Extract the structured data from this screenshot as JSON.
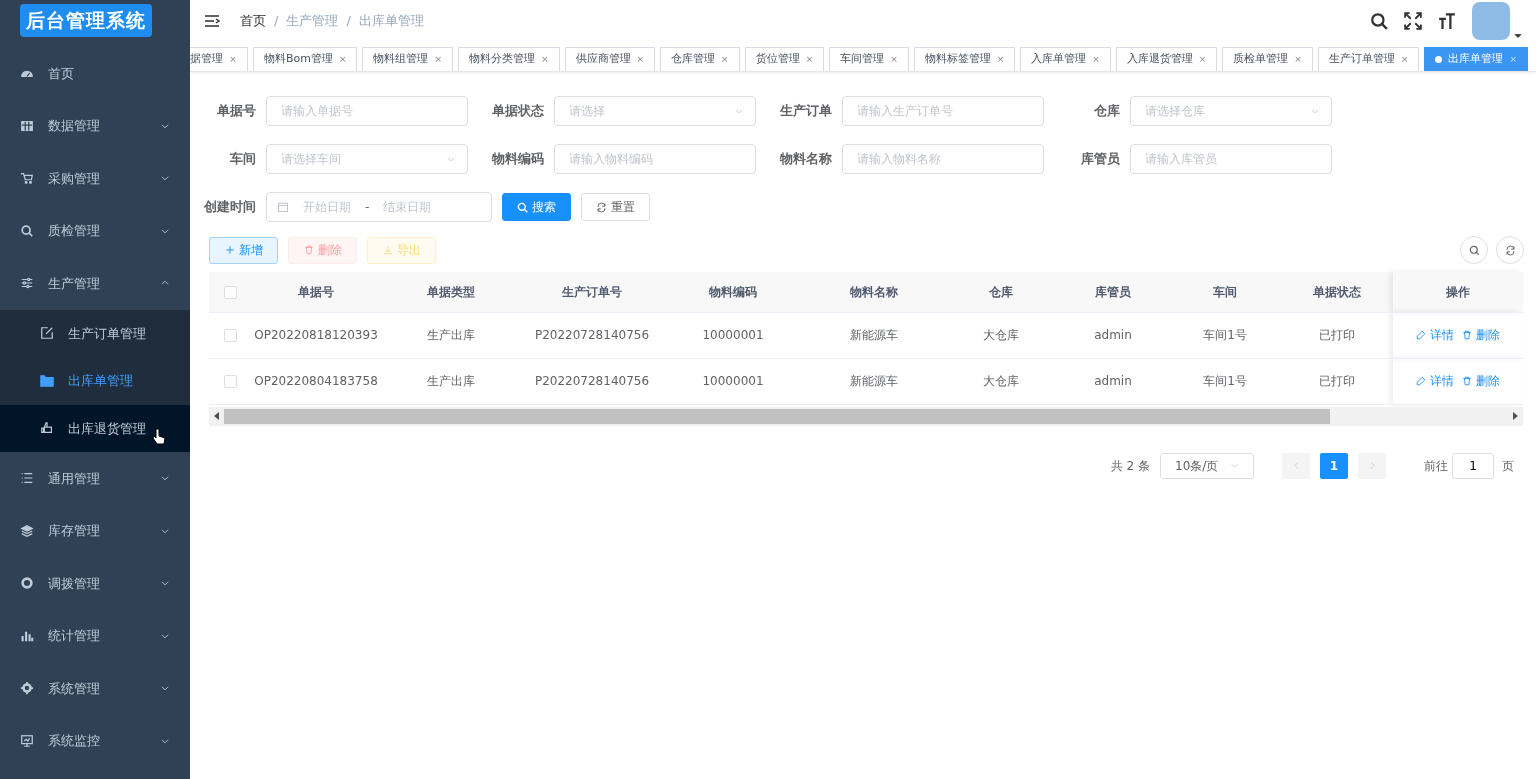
{
  "sidebar": {
    "logo": "后台管理系统",
    "items": [
      {
        "label": "首页",
        "kind": "link"
      },
      {
        "label": "数据管理",
        "kind": "group",
        "expanded": false
      },
      {
        "label": "采购管理",
        "kind": "group",
        "expanded": false
      },
      {
        "label": "质检管理",
        "kind": "group",
        "expanded": false
      },
      {
        "label": "生产管理",
        "kind": "group",
        "expanded": true,
        "children": [
          {
            "label": "生产订单管理",
            "selected": false,
            "hovered": false
          },
          {
            "label": "出库单管理",
            "selected": true,
            "hovered": false
          },
          {
            "label": "出库退货管理",
            "selected": false,
            "hovered": true
          }
        ]
      },
      {
        "label": "通用管理",
        "kind": "group",
        "expanded": false
      },
      {
        "label": "库存管理",
        "kind": "group",
        "expanded": false
      },
      {
        "label": "调拨管理",
        "kind": "group",
        "expanded": false
      },
      {
        "label": "统计管理",
        "kind": "group",
        "expanded": false
      },
      {
        "label": "系统管理",
        "kind": "group",
        "expanded": false
      },
      {
        "label": "系统监控",
        "kind": "group",
        "expanded": false
      }
    ]
  },
  "breadcrumb": {
    "separator": "/",
    "items": [
      "首页",
      "生产管理",
      "出库单管理"
    ]
  },
  "tab_close": "×",
  "tabs": [
    {
      "label": "据管理",
      "selected": false
    },
    {
      "label": "物料Bom管理",
      "selected": false
    },
    {
      "label": "物料组管理",
      "selected": false
    },
    {
      "label": "物料分类管理",
      "selected": false
    },
    {
      "label": "供应商管理",
      "selected": false
    },
    {
      "label": "仓库管理",
      "selected": false
    },
    {
      "label": "货位管理",
      "selected": false
    },
    {
      "label": "车间管理",
      "selected": false
    },
    {
      "label": "物料标签管理",
      "selected": false
    },
    {
      "label": "入库单管理",
      "selected": false
    },
    {
      "label": "入库退货管理",
      "selected": false
    },
    {
      "label": "质检单管理",
      "selected": false
    },
    {
      "label": "生产订单管理",
      "selected": false
    },
    {
      "label": "出库单管理",
      "selected": true
    }
  ],
  "filters": [
    {
      "label": "单据号",
      "kind": "input",
      "placeholder": "请输入单据号"
    },
    {
      "label": "单据状态",
      "kind": "select",
      "placeholder": "请选择"
    },
    {
      "label": "生产订单",
      "kind": "input",
      "placeholder": "请输入生产订单号"
    },
    {
      "label": "仓库",
      "kind": "select",
      "placeholder": "请选择仓库"
    },
    {
      "label": "车间",
      "kind": "select",
      "placeholder": "请选择车间"
    },
    {
      "label": "物料编码",
      "kind": "input",
      "placeholder": "请输入物料编码"
    },
    {
      "label": "物料名称",
      "kind": "input",
      "placeholder": "请输入物料名称"
    },
    {
      "label": "库管员",
      "kind": "input",
      "placeholder": "请输入库管员"
    },
    {
      "label": "创建时间",
      "kind": "daterange",
      "start_placeholder": "开始日期",
      "separator": "-",
      "end_placeholder": "结束日期"
    }
  ],
  "search_button": "搜索",
  "reset_button": "重置",
  "toolbar": [
    {
      "label": "新增",
      "kind": "add",
      "disabled": false
    },
    {
      "label": "删除",
      "kind": "delete",
      "disabled": true
    },
    {
      "label": "导出",
      "kind": "export",
      "disabled": true
    }
  ],
  "table": {
    "select_all_checked": false,
    "columns": [
      "单据号",
      "单据类型",
      "生产订单号",
      "物料编码",
      "物料名称",
      "仓库",
      "库管员",
      "车间",
      "单据状态",
      "操作"
    ],
    "rows": [
      {
        "checked": false,
        "cells": [
          "OP20220818120393",
          "生产出库",
          "P20220728140756",
          "10000001",
          "新能源车",
          "大仓库",
          "admin",
          "车间1号",
          "已打印"
        ],
        "actions": [
          "详情",
          "删除"
        ]
      },
      {
        "checked": false,
        "cells": [
          "OP20220804183758",
          "生产出库",
          "P20220728140756",
          "10000001",
          "新能源车",
          "大仓库",
          "admin",
          "车间1号",
          "已打印"
        ],
        "actions": [
          "详情",
          "删除"
        ]
      }
    ]
  },
  "pagination": {
    "total": "共 2 条",
    "page_size": "10条/页",
    "pages": [
      {
        "label": "1",
        "selected": true
      }
    ],
    "goto_label": "前往",
    "goto_value": "1",
    "goto_suffix": "页"
  }
}
